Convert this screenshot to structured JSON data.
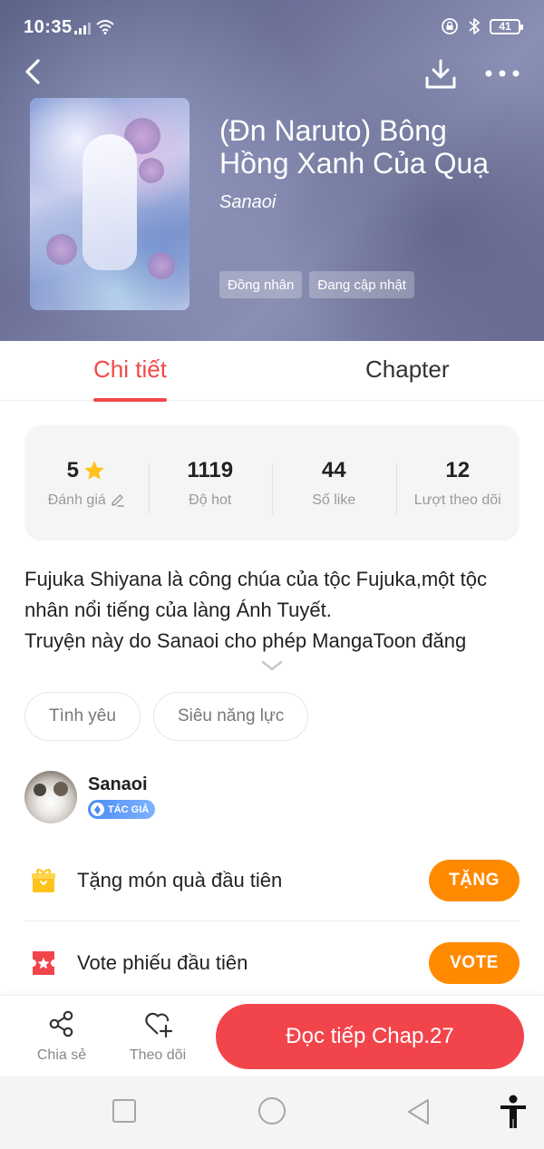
{
  "status_bar": {
    "time": "10:35",
    "battery": "41"
  },
  "book": {
    "title": "(Đn Naruto) Bông Hồng Xanh Của Quạ",
    "author": "Sanaoi",
    "genres": [
      "Đồng nhân",
      "Đang cập nhật"
    ]
  },
  "tabs": [
    {
      "label": "Chi tiết",
      "active": true
    },
    {
      "label": "Chapter",
      "active": false
    }
  ],
  "stats": [
    {
      "value": "5",
      "label": "Đánh giá"
    },
    {
      "value": "1119",
      "label": "Độ hot"
    },
    {
      "value": "44",
      "label": "Số like"
    },
    {
      "value": "12",
      "label": "Lượt theo dõi"
    }
  ],
  "description": {
    "line1": "Fujuka Shiyana là công chúa của tộc Fujuka,một tộc nhân nổi tiếng của làng Ánh Tuyết.",
    "line2": "Truyện này do Sanaoi cho phép MangaToon đăng"
  },
  "topics": [
    "Tình yêu",
    "Siêu năng lực"
  ],
  "author_section": {
    "name": "Sanaoi",
    "badge": "TÁC GIẢ"
  },
  "actions": [
    {
      "label": "Tặng món quà đầu tiên",
      "button": "TẶNG",
      "icon": "gift-icon"
    },
    {
      "label": "Vote phiếu đầu tiên",
      "button": "VOTE",
      "icon": "ticket-icon"
    }
  ],
  "bottom_bar": {
    "share_label": "Chia sẻ",
    "follow_label": "Theo dõi",
    "read_label": "Đọc tiếp Chap.27"
  },
  "colors": {
    "accent": "#f24949",
    "orange": "#ff8a00",
    "read_button": "#f2444b"
  }
}
